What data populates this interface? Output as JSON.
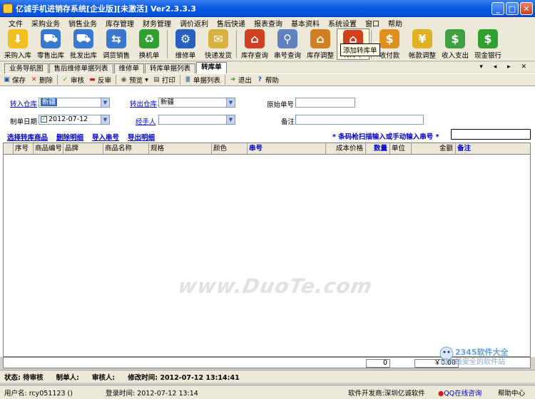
{
  "window": {
    "title": "亿诚手机进销存系统[企业版][未激活] Ver2.3.3.3"
  },
  "menu": [
    "文件",
    "采购业务",
    "销售业务",
    "库存管理",
    "财务管理",
    "调价返利",
    "售后快递",
    "报表查询",
    "基本资料",
    "系统设置",
    "窗口",
    "帮助"
  ],
  "toolbar": [
    {
      "label": "采购入库",
      "icon": "purchase-in-icon",
      "color": "#f0c020"
    },
    {
      "label": "零售出库",
      "icon": "retail-cart-icon",
      "color": "#3a78d0"
    },
    {
      "label": "批发出库",
      "icon": "wholesale-cart-icon",
      "color": "#3a78d0"
    },
    {
      "label": "调货销售",
      "icon": "transfer-sale-icon",
      "color": "#3a78d0"
    },
    {
      "label": "换机单",
      "icon": "exchange-icon",
      "color": "#30a030"
    },
    {
      "label": "维修单",
      "icon": "repair-icon",
      "color": "#2860c0"
    },
    {
      "label": "快递发货",
      "icon": "envelope-icon",
      "color": "#d8b040"
    },
    {
      "label": "库存查询",
      "icon": "house-icon",
      "color": "#d04020"
    },
    {
      "label": "串号查询",
      "icon": "magnifier-icon",
      "color": "#6080c0"
    },
    {
      "label": "库存调整",
      "icon": "stock-adjust-icon",
      "color": "#d08020"
    },
    {
      "label": "转库单",
      "icon": "warehouse-transfer-icon",
      "color": "#d04020"
    },
    {
      "label": "收付款",
      "icon": "payment-icon",
      "color": "#e09020"
    },
    {
      "label": "帐款调整",
      "icon": "account-adjust-icon",
      "color": "#e0b020"
    },
    {
      "label": "收入支出",
      "icon": "income-expense-icon",
      "color": "#40a040"
    },
    {
      "label": "现金银行",
      "icon": "dollar-icon",
      "color": "#30a030"
    }
  ],
  "tooltip": "添加转库单",
  "tabs": [
    "业务导航图",
    "售后维修单据列表",
    "维修单",
    "转库单据列表",
    "转库单"
  ],
  "actions": [
    {
      "label": "保存",
      "icon": "save-icon"
    },
    {
      "label": "删除",
      "icon": "delete-icon"
    },
    {
      "label": "审核",
      "icon": "check-icon"
    },
    {
      "label": "反审",
      "icon": "unaudit-icon"
    },
    {
      "label": "预览",
      "icon": "preview-icon"
    },
    {
      "label": "打印",
      "icon": "print-icon"
    },
    {
      "label": "单据列表",
      "icon": "list-icon"
    },
    {
      "label": "退出",
      "icon": "exit-icon"
    },
    {
      "label": "帮助",
      "icon": "help-icon"
    }
  ],
  "form": {
    "in_warehouse_label": "转入仓库",
    "in_warehouse_value": "新疆",
    "out_warehouse_label": "转出仓库",
    "out_warehouse_value": "新疆",
    "orig_no_label": "原始单号",
    "orig_no_value": "",
    "date_label": "制单日期",
    "date_value": "2012-07-12",
    "handler_label": "经手人",
    "handler_value": "",
    "remark_label": "备注",
    "remark_value": ""
  },
  "detail_links": [
    "选择转库商品",
    "删除明细",
    "导入串号",
    "导出明细"
  ],
  "scan_label": "* 条码枪扫描输入或手动输入串号 *",
  "grid_columns": [
    "序号",
    "商品编号",
    "品牌",
    "商品名称",
    "规格",
    "颜色",
    "串号",
    "成本价格",
    "数量",
    "单位",
    "金额",
    "备注"
  ],
  "totals": {
    "qty": "0",
    "amount": "￥0.00"
  },
  "watermark": "www.DuoTe.com",
  "status": {
    "state": "状态: 待审核",
    "maker": "制单人:",
    "auditor": "审核人:",
    "modified": "修改时间: 2012-07-12 13:14:41",
    "user": "用户名: rcy051123 ()",
    "login": "登录时间: 2012-07-12 13:14",
    "developer": "软件开发商:深圳亿诚软件",
    "qq": "QQ在线咨询",
    "help": "帮助中心"
  },
  "logo": {
    "brand": "2345软件大全",
    "slogan": "国内最安全的软件站"
  }
}
